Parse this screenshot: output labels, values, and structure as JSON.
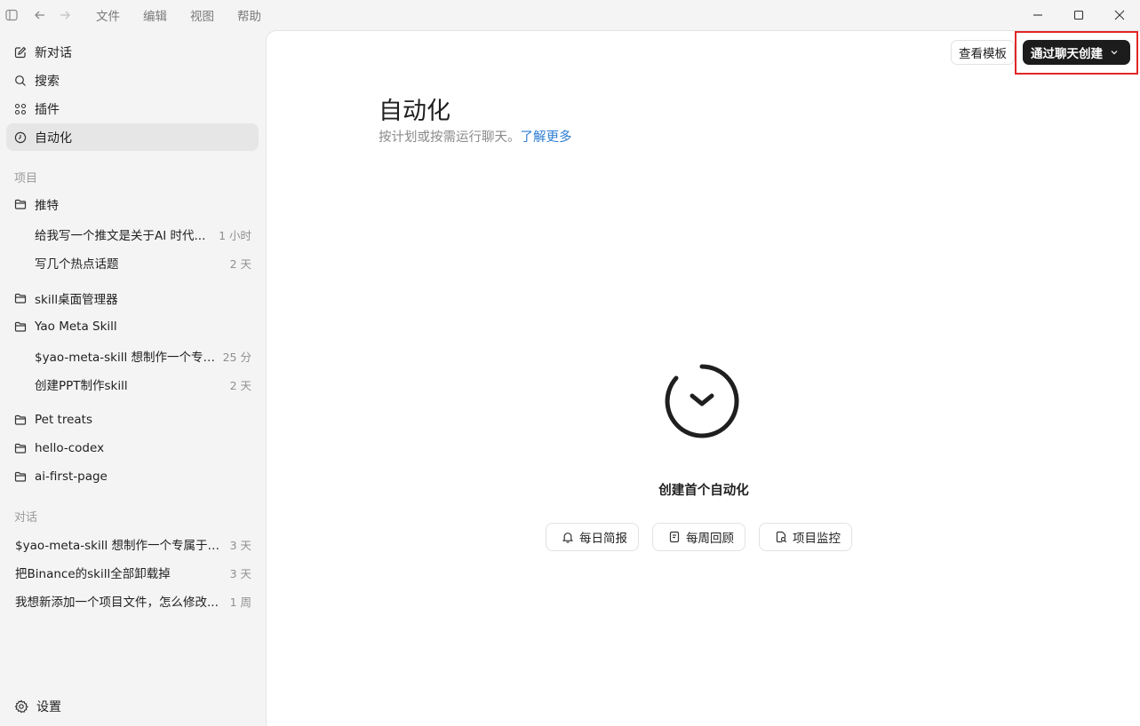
{
  "titlebar": {
    "menus": [
      "文件",
      "编辑",
      "视图",
      "帮助"
    ]
  },
  "sidebar": {
    "nav": [
      {
        "label": "新对话",
        "icon": "edit-icon"
      },
      {
        "label": "搜索",
        "icon": "search-icon"
      },
      {
        "label": "插件",
        "icon": "grid-icon"
      },
      {
        "label": "自动化",
        "icon": "clock-icon",
        "active": true
      }
    ],
    "projects_label": "项目",
    "projects": [
      {
        "name": "推特",
        "threads": [
          {
            "title": "给我写一个推文是关于AI 时代...",
            "time": "1 小时"
          },
          {
            "title": "写几个热点话题",
            "time": "2 天"
          }
        ]
      },
      {
        "name": "skill桌面管理器",
        "threads": []
      },
      {
        "name": "Yao Meta Skill",
        "threads": [
          {
            "title": "$yao-meta-skill 想制作一个专属...",
            "time": "25 分"
          },
          {
            "title": "创建PPT制作skill",
            "time": "2 天"
          }
        ]
      },
      {
        "name": "Pet treats",
        "threads": []
      },
      {
        "name": "hello-codex",
        "threads": []
      },
      {
        "name": "ai-first-page",
        "threads": []
      }
    ],
    "chats_label": "对话",
    "chats": [
      {
        "title": "$yao-meta-skill 想制作一个专属于我...",
        "time": "3 天"
      },
      {
        "title": "把Binance的skill全部卸载掉",
        "time": "3 天"
      },
      {
        "title": "我想新添加一个项目文件，怎么修改...",
        "time": "1 周"
      }
    ],
    "settings_label": "设置"
  },
  "main": {
    "templates_button": "查看模板",
    "create_button": "通过聊天创建",
    "title": "自动化",
    "subtitle": "按计划或按需运行聊天。",
    "learn_more": "了解更多",
    "empty_title": "创建首个自动化",
    "chips": [
      {
        "label": "每日简报",
        "icon": "bell-icon"
      },
      {
        "label": "每周回顾",
        "icon": "document-icon"
      },
      {
        "label": "项目监控",
        "icon": "file-search-icon"
      }
    ],
    "highlight_color": "#e12727"
  }
}
